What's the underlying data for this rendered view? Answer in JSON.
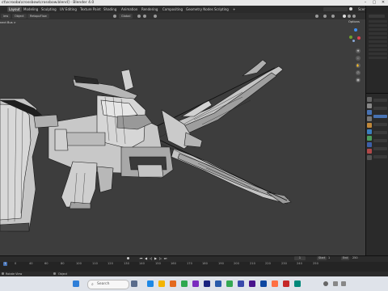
{
  "window": {
    "title": "ct\\scrooba\\crossbow\\crossbow.blend] - Blender 4.0",
    "controls": [
      "–",
      "▢",
      "✕"
    ]
  },
  "menubar": {
    "items": [
      "Layout",
      "Modeling",
      "Sculpting",
      "UV Editing",
      "Texture Paint",
      "Shading",
      "Animation",
      "Rendering",
      "Compositing",
      "Geometry Nodes",
      "Scripting",
      "+"
    ],
    "active_index": 0,
    "scene_label": "Scene"
  },
  "header": {
    "view_label": "iew",
    "object_menu": "Object",
    "retopo_label": "RetopoFlow",
    "transform_orientation": "Global",
    "options_label": "Options"
  },
  "viewport": {
    "info_label": "nect Bus >",
    "nav_icons": [
      "✥",
      "⌕",
      "✋",
      "⎚",
      "▦"
    ]
  },
  "timeline": {
    "ticks": [
      "0",
      "40",
      "60",
      "80",
      "100",
      "110",
      "120",
      "130",
      "140",
      "150",
      "160",
      "170",
      "180",
      "190",
      "200",
      "210",
      "220",
      "230",
      "240",
      "250"
    ],
    "current_frame": "1",
    "start_label": "Start",
    "start_value": "1",
    "end_label": "End",
    "end_value": "250",
    "marker": "1"
  },
  "statusbar": {
    "left": "Rotate View",
    "middle": "Object"
  },
  "taskbar": {
    "search_placeholder": "Search",
    "clock_time": "",
    "clock_date": ""
  },
  "colors": {
    "accent": "#4772b3",
    "viewport_bg": "#3d3d3d",
    "mesh_fill": "#bdbdbd",
    "wire": "#1a1a1a"
  }
}
